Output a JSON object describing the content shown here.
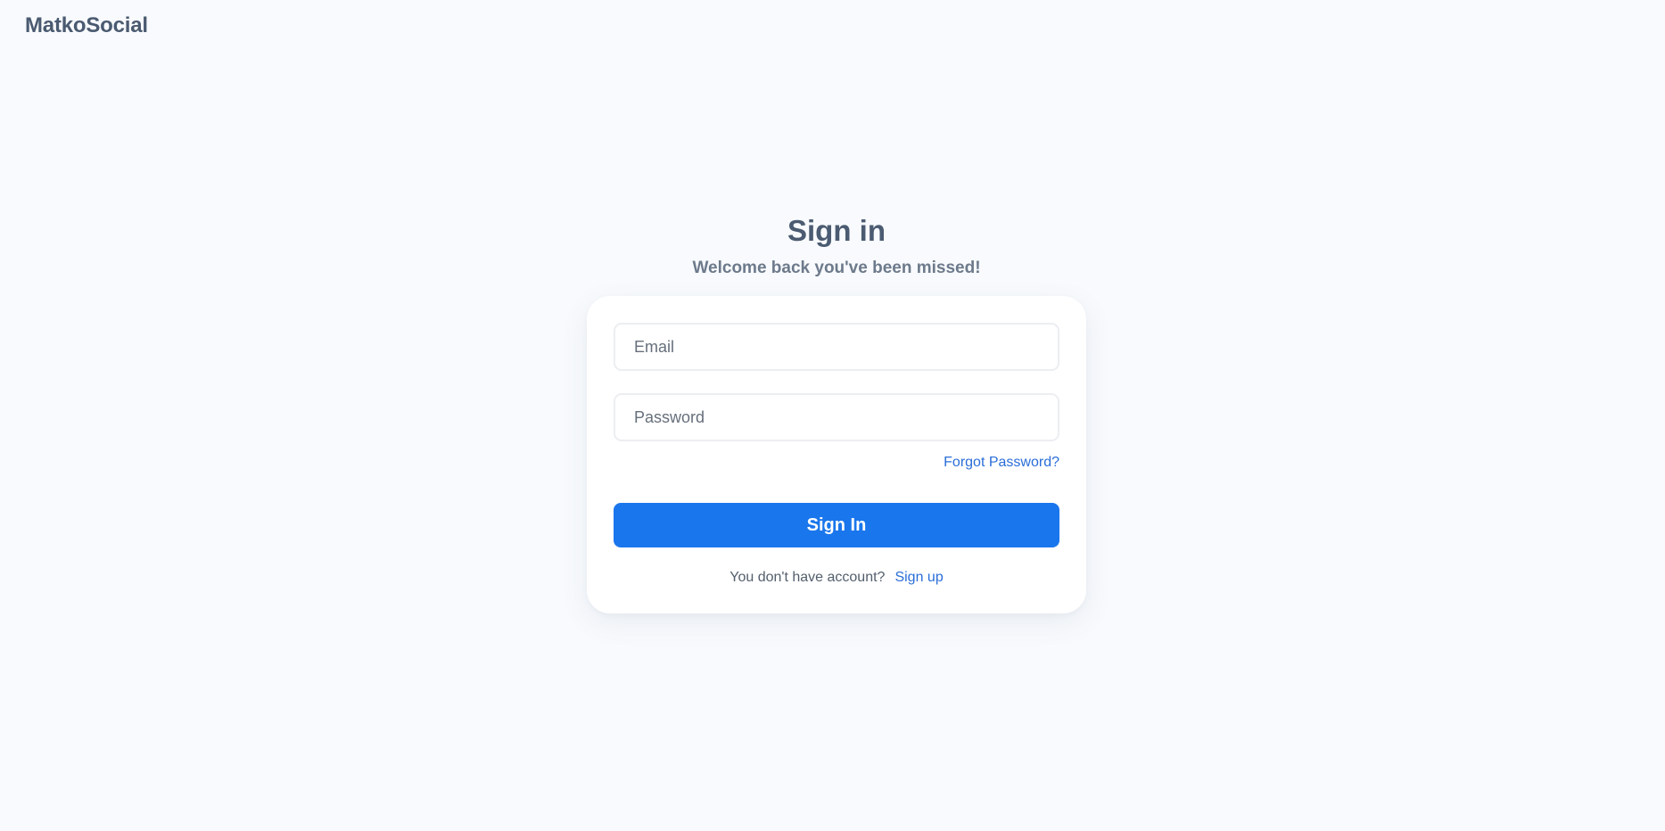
{
  "brand": {
    "name": "MatkoSocial"
  },
  "signin": {
    "title": "Sign in",
    "subtitle": "Welcome back you've been missed!",
    "email": {
      "value": "",
      "placeholder": "Email"
    },
    "password": {
      "value": "",
      "placeholder": "Password"
    },
    "forgot_password_label": "Forgot Password?",
    "submit_label": "Sign In",
    "no_account_text": "You don't have account?",
    "signup_label": "Sign up"
  },
  "colors": {
    "background": "#f8fafd",
    "primary": "#1a76ec",
    "link": "#2a6ed8",
    "heading": "#4b5b71"
  }
}
